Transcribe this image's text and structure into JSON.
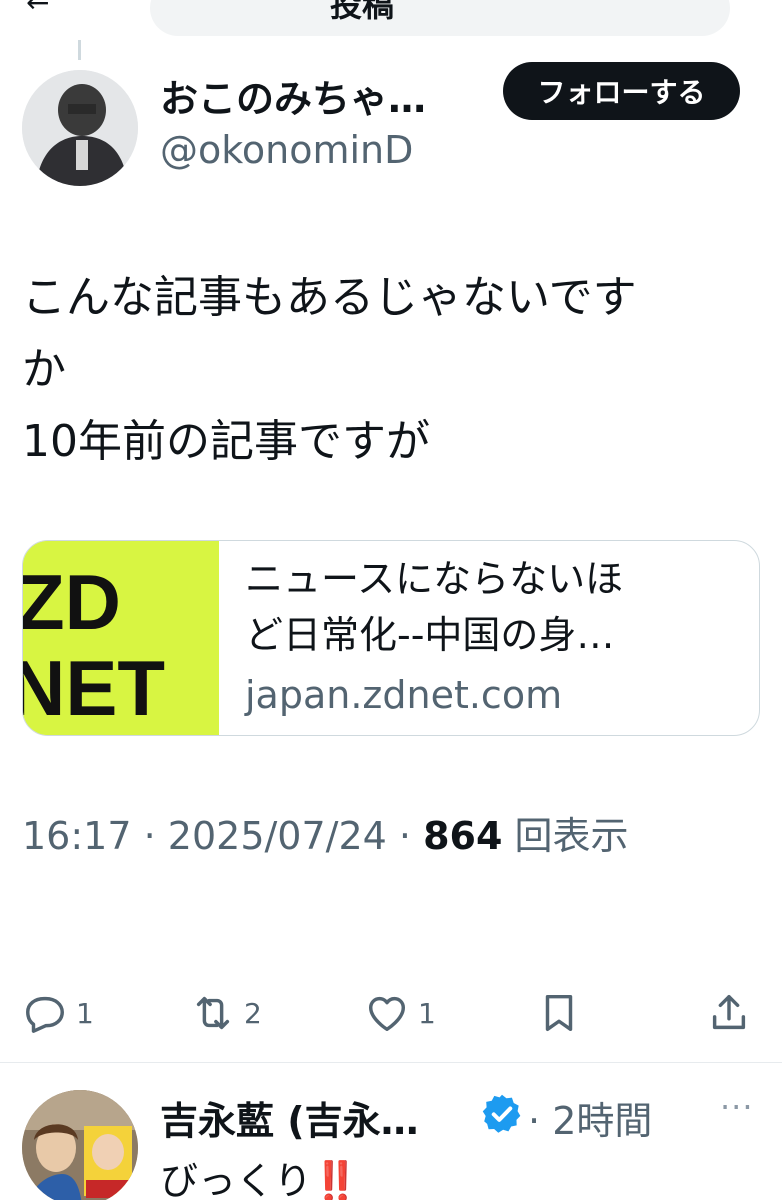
{
  "topbar": {
    "back_glyph": "←",
    "title_fragment": "投稿"
  },
  "tweet": {
    "display_name": "おこのみちゃ…",
    "handle": "@okonominD",
    "follow_label": "フォローする",
    "text_lines": [
      "こんな記事もあるじゃないです",
      "か",
      "10年前の記事ですが"
    ],
    "card": {
      "logo_line1": "ZD",
      "logo_line2": "NET",
      "title_lines": [
        "ニュースにならないほ",
        "ど日常化--中国の身…"
      ],
      "domain": "japan.zdnet.com",
      "thumb_color": "#d8f542"
    },
    "time": "16:17",
    "date": "2025/07/24",
    "separator": "·",
    "views_count": "864",
    "views_label": "回表示",
    "actions": {
      "reply_count": "1",
      "retweet_count": "2",
      "like_count": "1"
    }
  },
  "reply": {
    "display_name": "吉永藍 (吉永…",
    "time_separator": "·",
    "time": "2時間",
    "more_glyph": "···",
    "text": "びっくり",
    "emoji": "‼️",
    "verified_color": "#1d9bf0"
  },
  "colors": {
    "text": "#0f1419",
    "secondary": "#536471",
    "border": "#cfd9de"
  }
}
